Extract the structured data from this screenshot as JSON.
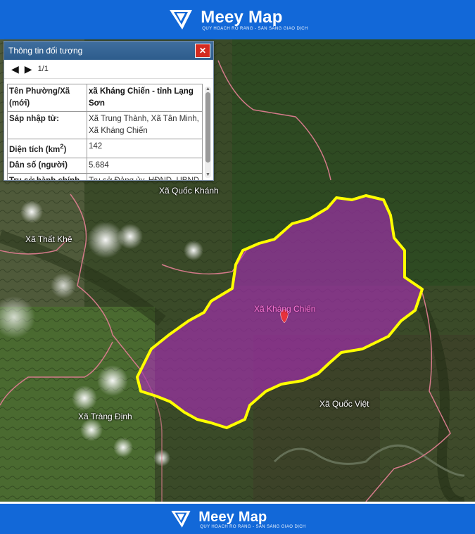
{
  "brand": {
    "name": "Meey Map",
    "tagline": "QUY HOẠCH RÕ RÀNG - SẴN SÀNG GIAO DỊCH"
  },
  "info_panel": {
    "title": "Thông tin đối tượng",
    "close_label": "✕",
    "pager": "1/1",
    "rows": [
      {
        "key": "Tên Phường/Xã (mới)",
        "value": "xã Kháng Chiến - tỉnh Lạng Sơn"
      },
      {
        "key": "Sáp nhập từ:",
        "value": "Xã Trung Thành, Xã Tân Minh, Xã Kháng Chiến"
      },
      {
        "key": "Diện tích (km²)",
        "value": "142"
      },
      {
        "key": "Dân số (người)",
        "value": "5.684"
      },
      {
        "key": "Trụ sở hành chính (mới)",
        "value": "Trụ sở Đảng ủy, HĐND, UBND xã Kháng Chiến"
      }
    ]
  },
  "map": {
    "labels": {
      "quoc_khanh": "Xã Quốc Khánh",
      "that_khe": "Xã Thất Khê",
      "khang_chien": "Xã Kháng Chiến",
      "trang_dinh": "Xã Tràng Định",
      "quoc_viet": "Xã Quốc Việt"
    },
    "colors": {
      "highlight_fill": "#b02cc0",
      "highlight_border": "#ffff00",
      "marker": "#e8323c"
    }
  }
}
